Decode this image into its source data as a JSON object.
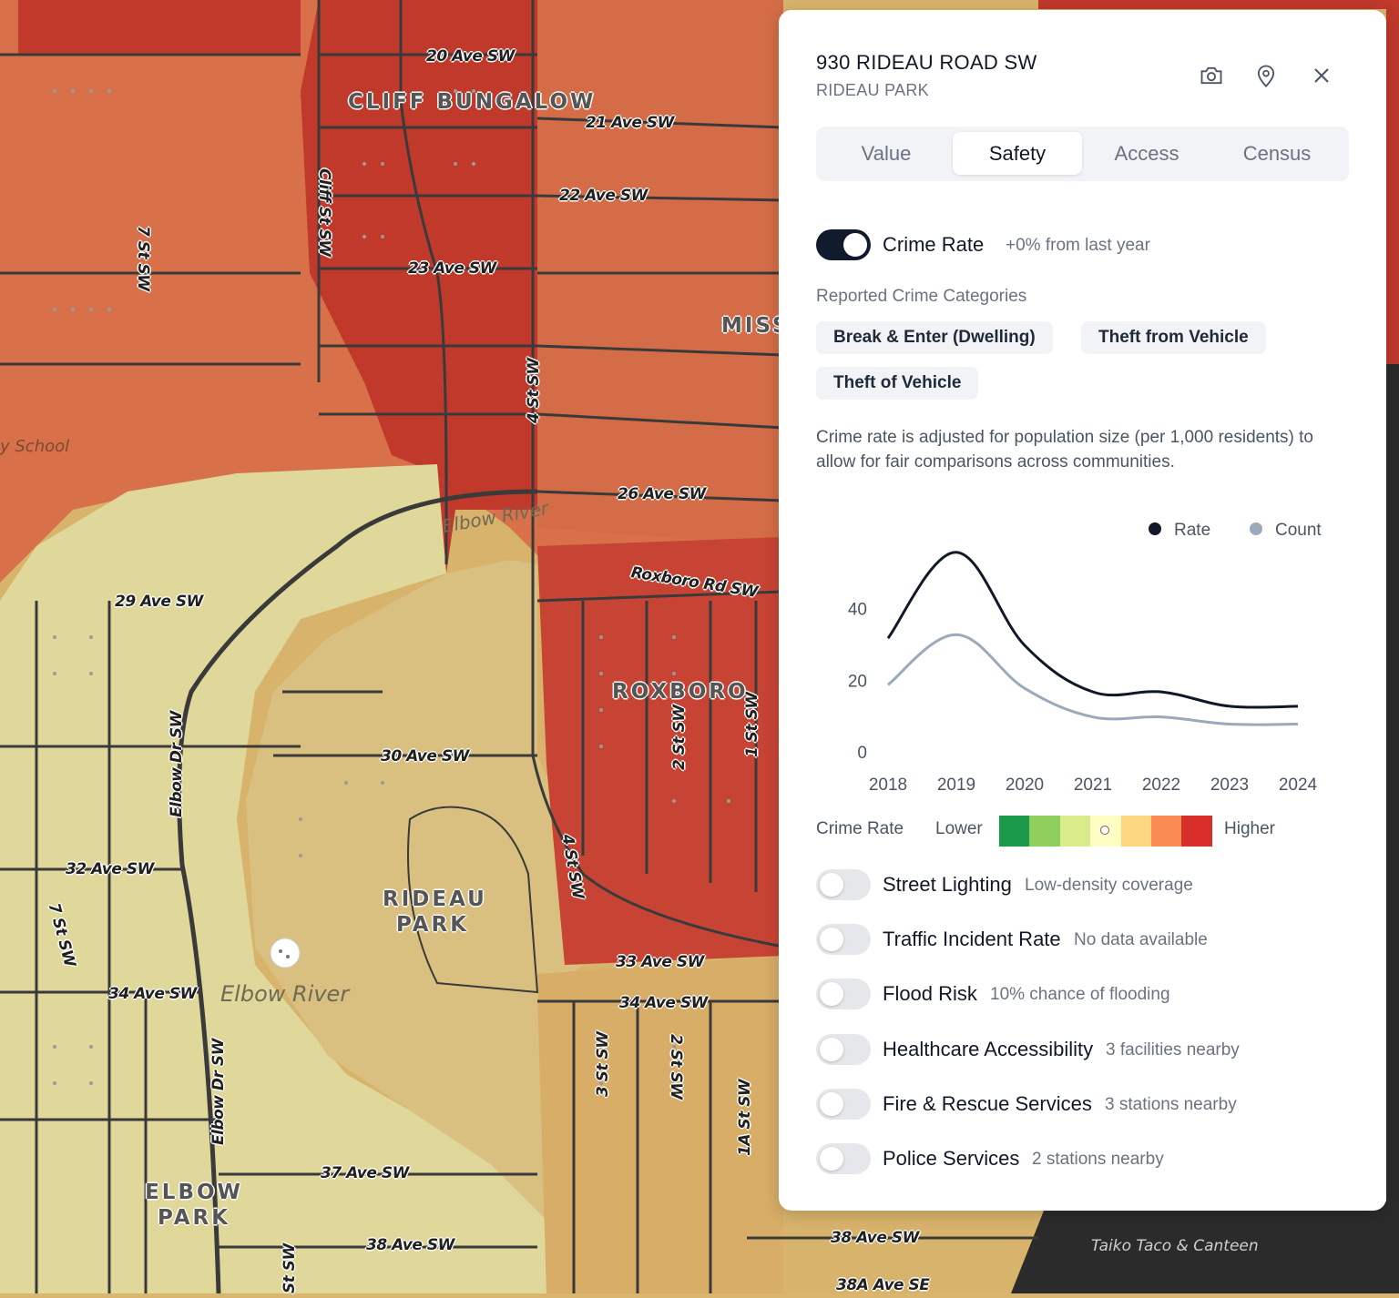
{
  "map": {
    "streets": [
      "20 Ave SW",
      "21 Ave SW",
      "22 Ave SW",
      "23 Ave SW",
      "26 Ave SW",
      "Cliff St SW",
      "7 St SW",
      "4 St SW",
      "Roxboro Rd SW",
      "29 Ave SW",
      "Elbow Dr SW",
      "30 Ave SW",
      "2 St SW",
      "1 St SW",
      "32 Ave SW",
      "7 St SW",
      "34 Ave SW",
      "33 Ave SW",
      "34 Ave SW",
      "3 St SW",
      "2 St SW",
      "1A St SW",
      "37 Ave SW",
      "38 Ave SW",
      "38 Ave SW",
      "38A Ave SE",
      "Elbow Dr SW",
      "4 St SW",
      "St SW"
    ],
    "neighbourhoods": [
      "CLIFF BUNGALOW",
      "ROXBORO",
      "RIDEAU PARK",
      "ELBOW PARK",
      "MISS"
    ],
    "rivers": [
      "Elbow River",
      "Elbow River"
    ],
    "pois": [
      "y School",
      "Taiko Taco & Canteen"
    ]
  },
  "panel": {
    "address": "930 RIDEAU ROAD SW",
    "community": "RIDEAU PARK",
    "icons": [
      "camera-icon",
      "map-pin-icon",
      "close-icon"
    ],
    "tabs": [
      "Value",
      "Safety",
      "Access",
      "Census"
    ],
    "active_tab": "Safety",
    "crime": {
      "label": "Crime Rate",
      "change": "+0% from last year",
      "enabled": true,
      "categories_label": "Reported Crime Categories",
      "categories": [
        "Break & Enter (Dwelling)",
        "Theft from Vehicle",
        "Theft of Vehicle"
      ],
      "description": "Crime rate is adjusted for population size (per 1,000 residents) to allow for fair comparisons across communities."
    },
    "scale": {
      "label": "Crime Rate",
      "lower": "Lower",
      "higher": "Higher",
      "colors": [
        "#1a9a4a",
        "#8fcf5e",
        "#d9ec8c",
        "#fdfdc4",
        "#fdd780",
        "#fb8b55",
        "#d92f2a"
      ],
      "current_index": 3
    },
    "layers": [
      {
        "label": "Street Lighting",
        "note": "Low-density coverage",
        "enabled": false
      },
      {
        "label": "Traffic Incident Rate",
        "note": "No data available",
        "enabled": false
      },
      {
        "label": "Flood Risk",
        "note": "10% chance of flooding",
        "enabled": false
      },
      {
        "label": "Healthcare Accessibility",
        "note": "3 facilities nearby",
        "enabled": false
      },
      {
        "label": "Fire & Rescue Services",
        "note": "3 stations nearby",
        "enabled": false
      },
      {
        "label": "Police Services",
        "note": "2 stations nearby",
        "enabled": false
      }
    ]
  },
  "chart_data": {
    "type": "line",
    "x": [
      "2018",
      "2019",
      "2020",
      "2021",
      "2022",
      "2023",
      "2024"
    ],
    "series": [
      {
        "name": "Rate",
        "color": "#111827",
        "values": [
          32,
          56,
          30,
          17,
          17,
          13,
          13
        ]
      },
      {
        "name": "Count",
        "color": "#9aaabb",
        "values": [
          19,
          33,
          18,
          10,
          10,
          8,
          8
        ]
      }
    ],
    "yticks": [
      0,
      20,
      40
    ],
    "ylim": [
      0,
      60
    ],
    "legend": "top-right",
    "grid": false
  }
}
